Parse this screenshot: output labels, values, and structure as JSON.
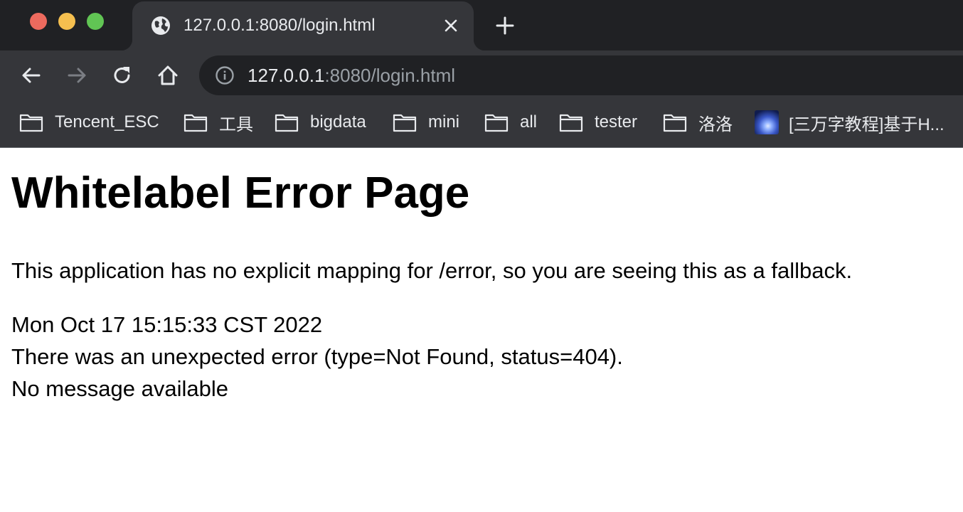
{
  "window": {
    "controls": [
      "close",
      "minimize",
      "zoom"
    ],
    "colors": {
      "close": "#ed6a5e",
      "minimize": "#f5bf4f",
      "zoom": "#61c554"
    }
  },
  "tab": {
    "icon": "globe-icon",
    "title": "127.0.0.1:8080/login.html",
    "close_icon": "close-icon",
    "new_tab_icon": "plus-icon"
  },
  "toolbar": {
    "back_icon": "back-arrow-icon",
    "forward_icon": "forward-arrow-icon",
    "reload_icon": "reload-icon",
    "home_icon": "home-icon",
    "site_info_icon": "info-icon",
    "url_host": "127.0.0.1",
    "url_rest": ":8080/login.html"
  },
  "bookmarks": [
    {
      "label": "Tencent_ESC",
      "icon": "folder-icon"
    },
    {
      "label": "工具",
      "icon": "folder-icon"
    },
    {
      "label": "bigdata",
      "icon": "folder-icon"
    },
    {
      "label": "mini",
      "icon": "folder-icon"
    },
    {
      "label": "all",
      "icon": "folder-icon"
    },
    {
      "label": "tester",
      "icon": "folder-icon"
    },
    {
      "label": "洛洛",
      "icon": "folder-icon"
    },
    {
      "label": "[三万字教程]基于H...",
      "icon": "site-favicon"
    }
  ],
  "page": {
    "heading": "Whitelabel Error Page",
    "explanation": "This application has no explicit mapping for /error, so you are seeing this as a fallback.",
    "timestamp": "Mon Oct 17 15:15:33 CST 2022",
    "error_line": "There was an unexpected error (type=Not Found, status=404).",
    "message": "No message available"
  }
}
